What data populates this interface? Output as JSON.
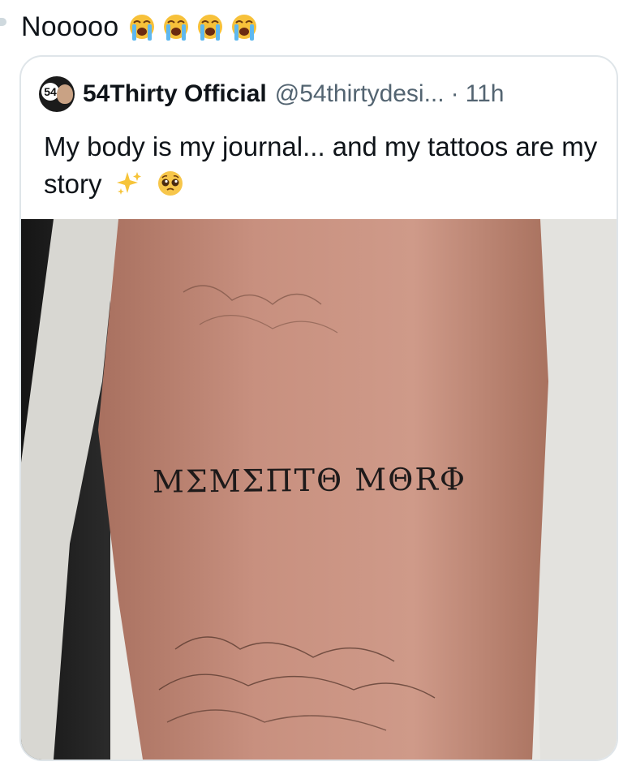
{
  "post": {
    "text": "Nooooo",
    "emojis": [
      "loudly-crying-face-icon",
      "loudly-crying-face-icon",
      "loudly-crying-face-icon",
      "loudly-crying-face-icon"
    ]
  },
  "quoted_tweet": {
    "display_name": "54Thirty Official",
    "handle": "@54thirtydesi...",
    "separator": "·",
    "time": "11h",
    "avatar_badge": "54",
    "text": "My body is my journal... and my tattoos are my story",
    "text_emojis": [
      "sparkles-icon",
      "pleading-face-icon"
    ],
    "image": {
      "tattoo_text": "ΜΣΜΣΠΤΘ ΜΘRΦ"
    }
  },
  "colors": {
    "text": "#0f1419",
    "secondary": "#536471",
    "border": "#dfe5e9",
    "skin": "#c78f7d",
    "towel": "#ecebe7"
  }
}
